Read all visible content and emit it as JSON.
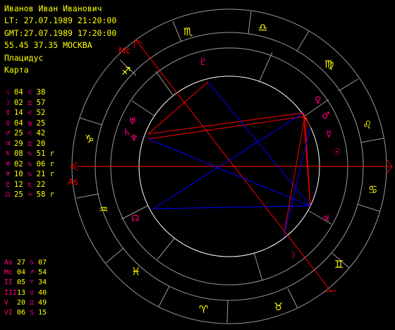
{
  "header": {
    "name": "Иванов Иван Иванович",
    "lt": "LT: 27.07.1989 21:20:00",
    "gmt": "GMT:27.07.1989 17:20:00",
    "location": "55.45 37.35 МОСКВА",
    "house_system": "Плацидус",
    "chart_type": "Карта"
  },
  "planets": [
    {
      "symbol": "☉",
      "deg": "04",
      "sign": "♌",
      "min": "38",
      "retro": ""
    },
    {
      "symbol": "☽",
      "deg": "02",
      "sign": "♊",
      "min": "57",
      "retro": ""
    },
    {
      "symbol": "☿",
      "deg": "14",
      "sign": "♌",
      "min": "52",
      "retro": ""
    },
    {
      "symbol": "♀",
      "deg": "04",
      "sign": "♍",
      "min": "25",
      "retro": ""
    },
    {
      "symbol": "♂",
      "deg": "25",
      "sign": "♌",
      "min": "42",
      "retro": ""
    },
    {
      "symbol": "♃",
      "deg": "29",
      "sign": "♊",
      "min": "20",
      "retro": ""
    },
    {
      "symbol": "♄",
      "deg": "08",
      "sign": "♑",
      "min": "51",
      "retro": "r"
    },
    {
      "symbol": "♅",
      "deg": "02",
      "sign": "♑",
      "min": "06",
      "retro": "r"
    },
    {
      "symbol": "♆",
      "deg": "10",
      "sign": "♑",
      "min": "21",
      "retro": "r"
    },
    {
      "symbol": "♇",
      "deg": "12",
      "sign": "♏",
      "min": "22",
      "retro": ""
    },
    {
      "symbol": "☊",
      "deg": "25",
      "sign": "♒",
      "min": "58",
      "retro": "r"
    }
  ],
  "houses": [
    {
      "label": "As",
      "deg": "27",
      "sign": "♑",
      "min": "07"
    },
    {
      "label": "Mc",
      "deg": "04",
      "sign": "♐",
      "min": "54"
    },
    {
      "label": "II",
      "deg": "05",
      "sign": "♈",
      "min": "34"
    },
    {
      "label": "III",
      "deg": "13",
      "sign": "♉",
      "min": "40"
    },
    {
      "label": "V",
      "deg": "20",
      "sign": "♊",
      "min": "49"
    },
    {
      "label": "VI",
      "deg": "06",
      "sign": "♋",
      "min": "15"
    }
  ],
  "wheel": {
    "asc_label": "As",
    "mc_label": "Mc",
    "zodiac_glyphs": [
      "♏",
      "♎",
      "♍",
      "♌",
      "♋",
      "♊",
      "♉",
      "♈",
      "♓",
      "♒",
      "♑",
      "♐"
    ],
    "wheel_planets": [
      "♀",
      "♂",
      "☿",
      "☉",
      "♃",
      "☽",
      "☊",
      "♅",
      "♄",
      "♆",
      "♇"
    ],
    "colors": {
      "yellow": "#ffff00",
      "magenta": "#ff0080",
      "ring": "#9a9a9a",
      "axis": "#ff0000",
      "blue": "#0000ff"
    }
  }
}
